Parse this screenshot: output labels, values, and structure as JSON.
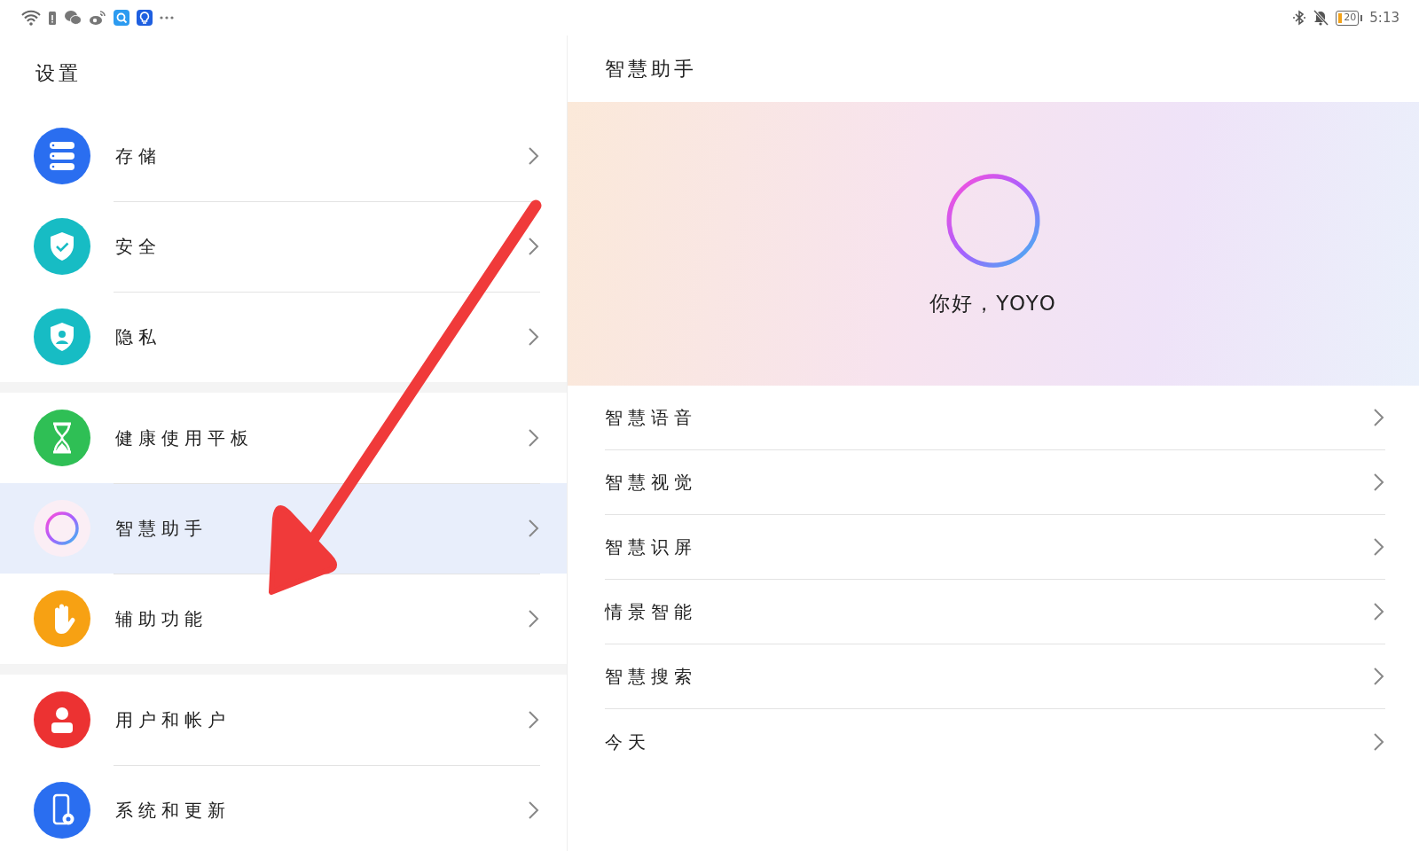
{
  "status_bar": {
    "battery": "20",
    "time": "5:13"
  },
  "settings": {
    "title": "设置",
    "groups": [
      {
        "items": [
          {
            "label": "存储",
            "kind": "storage",
            "selected": false
          },
          {
            "label": "安全",
            "kind": "security",
            "selected": false
          },
          {
            "label": "隐私",
            "kind": "privacy",
            "selected": false
          }
        ]
      },
      {
        "items": [
          {
            "label": "健康使用平板",
            "kind": "hourglass",
            "selected": false
          },
          {
            "label": "智慧助手",
            "kind": "assistant",
            "selected": true
          },
          {
            "label": "辅助功能",
            "kind": "hand",
            "selected": false
          }
        ]
      },
      {
        "items": [
          {
            "label": "用户和帐户",
            "kind": "user",
            "selected": false
          },
          {
            "label": "系统和更新",
            "kind": "system",
            "selected": false
          }
        ]
      }
    ]
  },
  "detail": {
    "title": "智慧助手",
    "greeting": "你好，YOYO",
    "items": [
      {
        "label": "智慧语音"
      },
      {
        "label": "智慧视觉"
      },
      {
        "label": "智慧识屏"
      },
      {
        "label": "情景智能"
      },
      {
        "label": "智慧搜索"
      },
      {
        "label": "今天"
      }
    ]
  }
}
